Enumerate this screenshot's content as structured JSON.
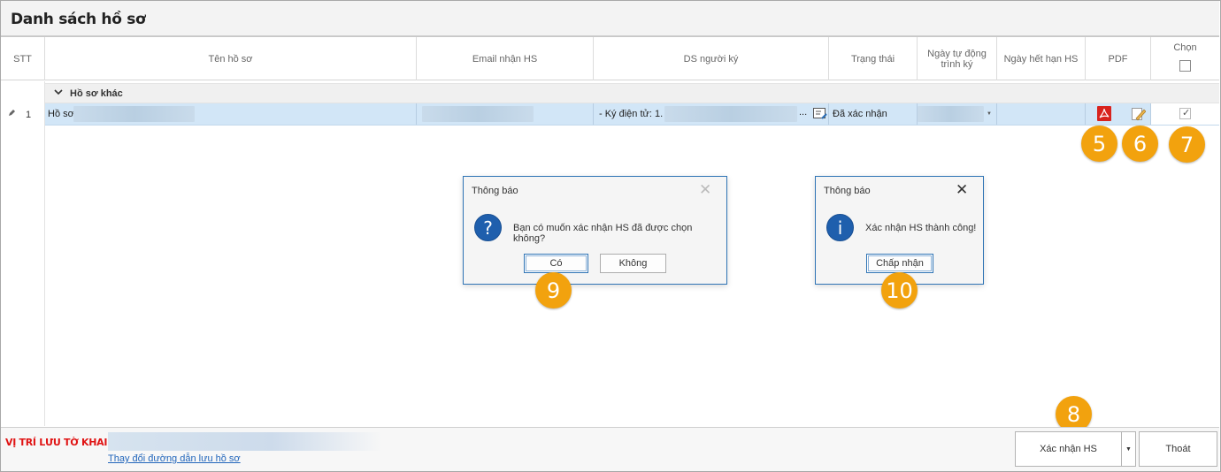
{
  "window": {
    "title": "Danh sách hồ sơ"
  },
  "columns": {
    "stt": "STT",
    "ten_ho_so": "Tên hồ sơ",
    "email": "Email nhận HS",
    "ds_nguoi_ky": "DS người ký",
    "trang_thai": "Trạng thái",
    "ngay_tu_dong": "Ngày tự động trình ký",
    "ngay_het_han": "Ngày hết hạn HS",
    "pdf": "PDF",
    "chon": "Chọn"
  },
  "group": {
    "label": "Hồ sơ khác"
  },
  "row": {
    "stt": "1",
    "ten_ho_so": "Hồ sơ",
    "ds_nguoi_ky": "- Ký điện tử: 1.",
    "ds_more": "...",
    "trang_thai": "Đã xác nhận",
    "chon_checked": true
  },
  "badges": {
    "b5": "5",
    "b6": "6",
    "b7": "7",
    "b8": "8",
    "b9": "9",
    "b10": "10"
  },
  "dialog_confirm": {
    "title": "Thông báo",
    "message": "Bạn có muốn xác nhận HS đã được chọn không?",
    "yes": "Có",
    "no": "Không",
    "icon": "question-icon"
  },
  "dialog_info": {
    "title": "Thông báo",
    "message": "Xác nhận HS thành công!",
    "ok": "Chấp nhận",
    "icon": "info-icon"
  },
  "footer": {
    "location_label": "VỊ TRÍ LƯU TỜ KHAI:",
    "change_path_link": "Thay đổi đường dẫn lưu hồ sơ",
    "confirm_button": "Xác nhận HS",
    "exit_button": "Thoát"
  },
  "colors": {
    "badge": "#f2a20e",
    "selected_row": "#d2e6f7",
    "dialog_border": "#2f74b5",
    "location_label": "#e01414"
  }
}
